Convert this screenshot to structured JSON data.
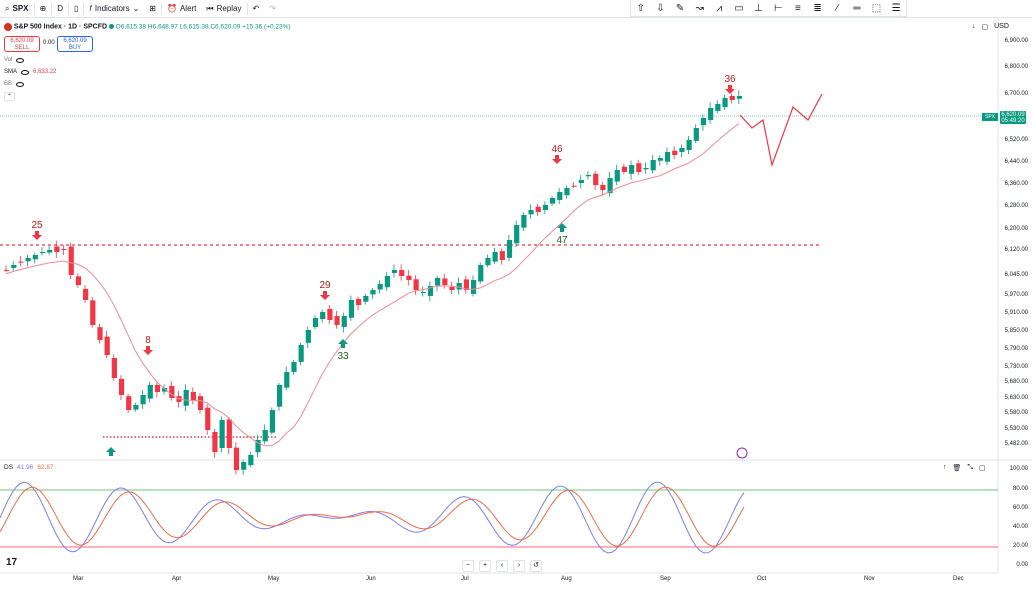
{
  "toolbar": {
    "symbol": "SPX",
    "interval": "D",
    "indicators_label": "Indicators",
    "alert_label": "Alert",
    "replay_label": "Replay"
  },
  "legend": {
    "title": "S&P 500 Index · 1D · SPCFD",
    "ohlc": "O6,615.38 H6,648.97 L6,615.38 C6,620.09 +15.36 (+0.23%)",
    "sell_price": "6,620.09",
    "sell_label": "SELL",
    "spread": "0.00",
    "buy_price": "6,620.09",
    "buy_label": "BUY",
    "vol_label": "Vol",
    "sma_label": "SMA",
    "sma_value": "6,633.22",
    "bb_label": "BB"
  },
  "currency": "USD",
  "price_axis": [
    "6,900.00",
    "6,800.00",
    "6,700.00",
    "6,620.09",
    "6,520.00",
    "6,440.00",
    "6,360.00",
    "6,280.00",
    "6,200.00",
    "6,120.00",
    "6,045.00",
    "5,970.00",
    "5,910.00",
    "5,850.00",
    "5,790.00",
    "5,730.00",
    "5,680.00",
    "5,630.00",
    "5,580.00",
    "5,530.00",
    "5,482.00"
  ],
  "last_price": "6,620.09",
  "countdown": "05:49:20",
  "spx_tag": "SPX",
  "markers": [
    {
      "label": "25",
      "dir": "sell"
    },
    {
      "label": "8",
      "dir": "sell"
    },
    {
      "label": "29",
      "dir": "sell"
    },
    {
      "label": "33",
      "dir": "buy"
    },
    {
      "label": "46",
      "dir": "sell"
    },
    {
      "label": "47",
      "dir": "buy"
    },
    {
      "label": "36",
      "dir": "sell"
    }
  ],
  "ds": {
    "label": "DS",
    "value1": "41.96",
    "value2": "62.87",
    "axis": [
      "100.00",
      "80.00",
      "60.00",
      "40.00",
      "20.00",
      "0.00"
    ],
    "k_color": "#7b7ef2",
    "d_color": "#f26b4a"
  },
  "x_axis": [
    "Mar",
    "Apr",
    "May",
    "Jun",
    "Jul",
    "Aug",
    "Sep",
    "Oct",
    "Nov",
    "Dec"
  ],
  "nav": [
    "−",
    "+",
    "‹",
    "›",
    "↺"
  ],
  "logo": "17",
  "colors": {
    "up": "#089981",
    "down": "#f23645",
    "sma": "#f28b96",
    "level": "#f23645"
  }
}
